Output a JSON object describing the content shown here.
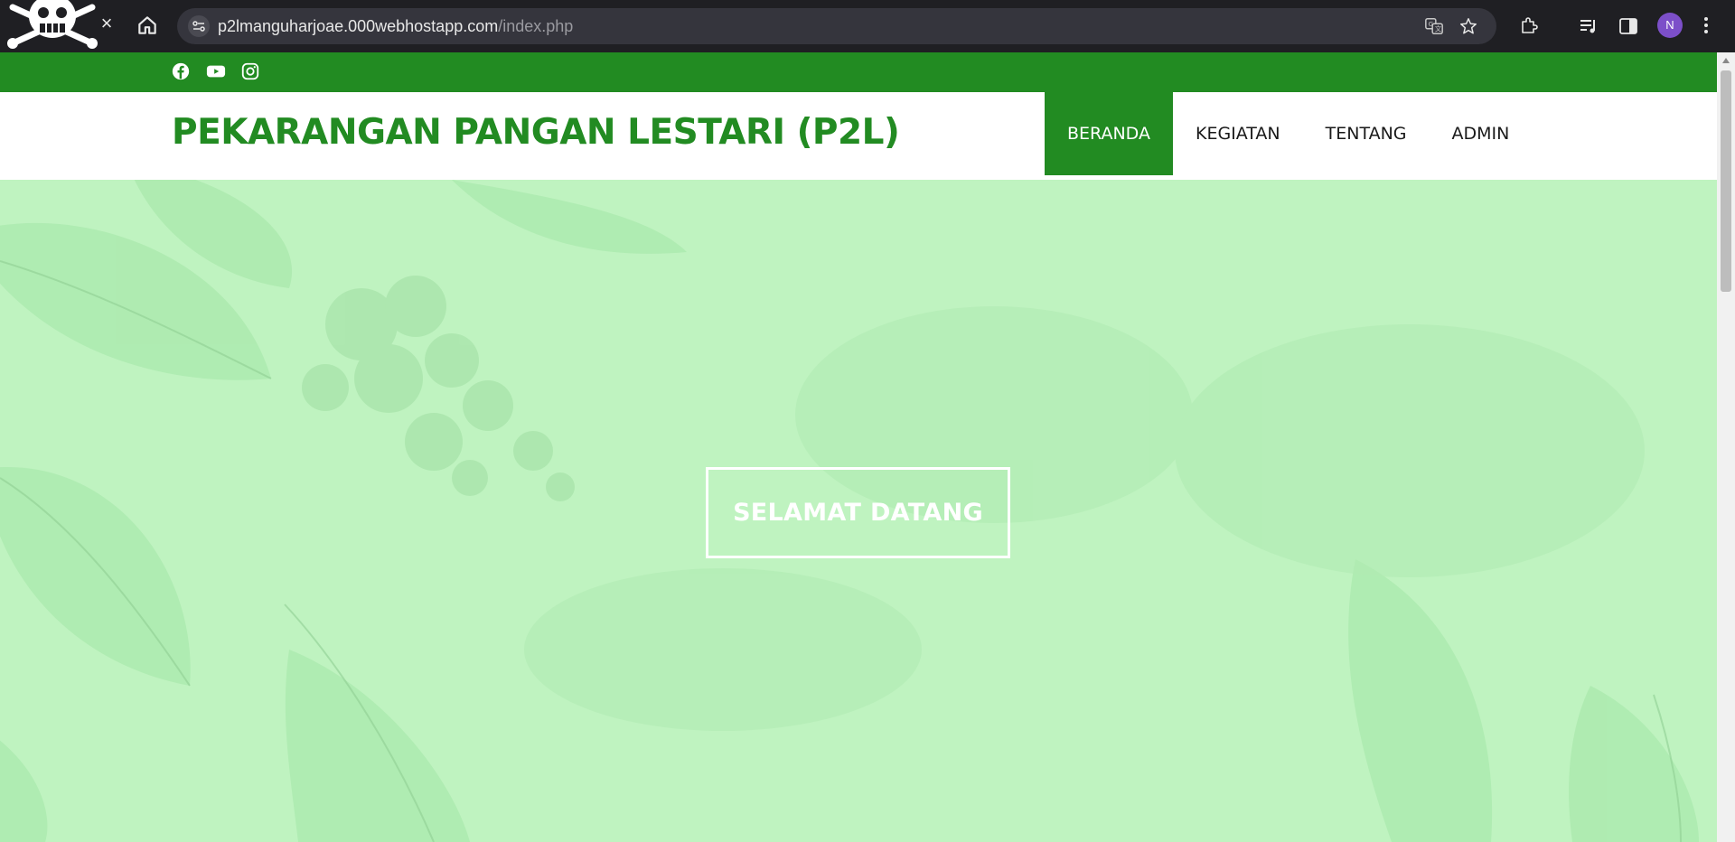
{
  "browser": {
    "url_domain": "p2lmanguharjoae.000webhostapp.com",
    "url_path": "/index.php",
    "profile_initial": "N",
    "close_glyph": "×"
  },
  "social": {
    "icons": [
      "facebook-icon",
      "youtube-icon",
      "instagram-icon"
    ]
  },
  "header": {
    "title": "PEKARANGAN PANGAN LESTARI (P2L)"
  },
  "nav": {
    "items": [
      {
        "label": "BERANDA",
        "active": true
      },
      {
        "label": "KEGIATAN",
        "active": false
      },
      {
        "label": "TENTANG",
        "active": false
      },
      {
        "label": "ADMIN",
        "active": false
      }
    ]
  },
  "hero": {
    "welcome": "SELAMAT DATANG"
  },
  "colors": {
    "brand_green": "#228b22",
    "hero_bg": "#bff3c0",
    "chrome_dark": "#1f1f23",
    "avatar_purple": "#7c4fc9"
  }
}
